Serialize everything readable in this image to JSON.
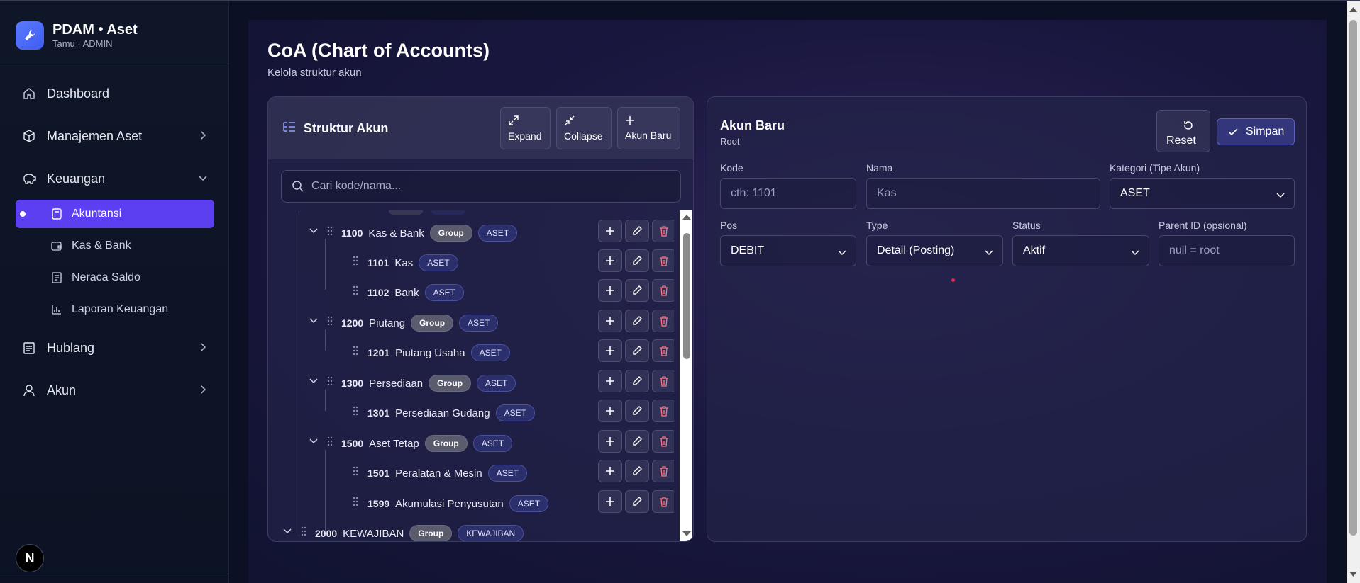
{
  "brand": {
    "title": "PDAM • Aset",
    "subtitle": "Tamu · ADMIN"
  },
  "nav": {
    "dashboard": "Dashboard",
    "manajemen_aset": "Manajemen Aset",
    "keuangan": "Keuangan",
    "keuangan_sub": [
      "Akuntansi",
      "Kas & Bank",
      "Neraca Saldo",
      "Laporan Keuangan"
    ],
    "hublang": "Hublang",
    "akun": "Akun"
  },
  "avatar_letter": "N",
  "page": {
    "title": "CoA (Chart of Accounts)",
    "subtitle": "Kelola struktur akun"
  },
  "tree_panel": {
    "title": "Struktur Akun",
    "buttons": {
      "expand": "Expand",
      "collapse": "Collapse",
      "new_account": "Akun Baru"
    },
    "search_placeholder": "Cari kode/nama...",
    "rows": [
      {
        "code": "1100",
        "name": "Kas & Bank",
        "group": "Group",
        "type": "ASET"
      },
      {
        "code": "1101",
        "name": "Kas",
        "type": "ASET"
      },
      {
        "code": "1102",
        "name": "Bank",
        "type": "ASET"
      },
      {
        "code": "1200",
        "name": "Piutang",
        "group": "Group",
        "type": "ASET"
      },
      {
        "code": "1201",
        "name": "Piutang Usaha",
        "type": "ASET"
      },
      {
        "code": "1300",
        "name": "Persediaan",
        "group": "Group",
        "type": "ASET"
      },
      {
        "code": "1301",
        "name": "Persediaan Gudang",
        "type": "ASET"
      },
      {
        "code": "1500",
        "name": "Aset Tetap",
        "group": "Group",
        "type": "ASET"
      },
      {
        "code": "1501",
        "name": "Peralatan & Mesin",
        "type": "ASET"
      },
      {
        "code": "1599",
        "name": "Akumulasi Penyusutan",
        "type": "ASET"
      },
      {
        "code": "2000",
        "name": "KEWAJIBAN",
        "group": "Group",
        "type": "KEWAJIBAN"
      }
    ]
  },
  "form_panel": {
    "title": "Akun Baru",
    "subtitle": "Root",
    "reset": "Reset",
    "save": "Simpan",
    "kode": {
      "label": "Kode",
      "placeholder": "cth: 1101"
    },
    "nama": {
      "label": "Nama",
      "placeholder": "Kas"
    },
    "kategori": {
      "label": "Kategori (Tipe Akun)",
      "value": "ASET"
    },
    "pos": {
      "label": "Pos",
      "value": "DEBIT"
    },
    "type": {
      "label": "Type",
      "value": "Detail (Posting)"
    },
    "status": {
      "label": "Status",
      "value": "Aktif"
    },
    "parent": {
      "label": "Parent ID (opsional)",
      "placeholder": "null = root"
    }
  },
  "colors": {
    "accent": "#5b3ff0",
    "brand": "#4f6dff",
    "delete": "#f07a8a"
  }
}
